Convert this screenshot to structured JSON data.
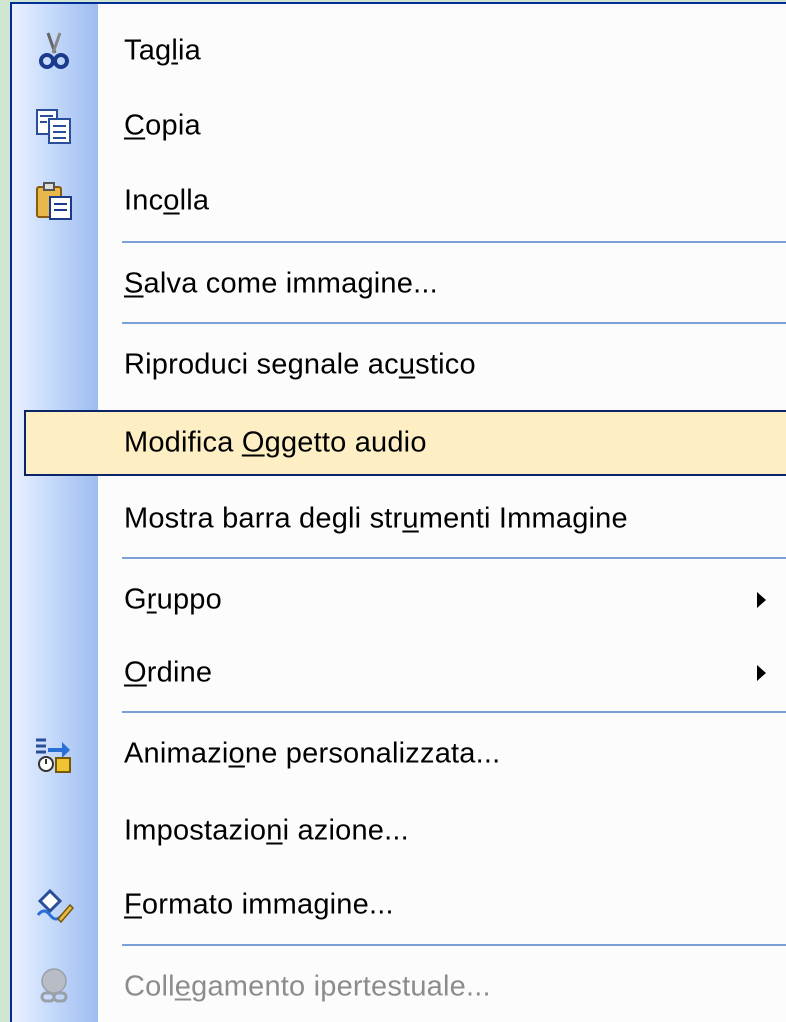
{
  "menu": {
    "items": [
      {
        "pre": "Tag",
        "u": "l",
        "post": "ia",
        "icon": "scissors-icon"
      },
      {
        "pre": "",
        "u": "C",
        "post": "opia",
        "icon": "copy-icon"
      },
      {
        "pre": "Inc",
        "u": "o",
        "post": "lla",
        "icon": "paste-icon"
      },
      {
        "pre": "",
        "u": "S",
        "post": "alva come immagine..."
      },
      {
        "pre": "Riproduci segnale ac",
        "u": "u",
        "post": "stico"
      },
      {
        "pre": "Modifica ",
        "u": "O",
        "post": "ggetto audio"
      },
      {
        "pre": "Mostra barra degli str",
        "u": "u",
        "post": "menti Immagine"
      },
      {
        "pre": "G",
        "u": "r",
        "post": "uppo"
      },
      {
        "pre": "",
        "u": "O",
        "post": "rdine"
      },
      {
        "pre": "Animazi",
        "u": "o",
        "post": "ne personalizzata...",
        "icon": "custom-animation-icon"
      },
      {
        "pre": "Impostazio",
        "u": "n",
        "post": "i azione..."
      },
      {
        "pre": "",
        "u": "F",
        "post": "ormato immagine...",
        "icon": "format-picture-icon"
      },
      {
        "pre": "Coll",
        "u": "e",
        "post": "gamento ipertestuale...",
        "icon": "hyperlink-icon"
      }
    ]
  }
}
